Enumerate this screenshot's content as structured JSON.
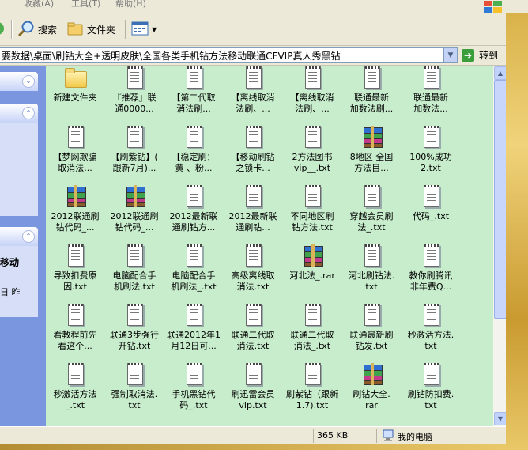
{
  "menu": {
    "items": [
      "收藏(A)",
      "工具(T)",
      "帮助(H)"
    ]
  },
  "toolbar": {
    "search_label": "搜索",
    "folders_label": "文件夹"
  },
  "address": {
    "path": "要数据\\桌面\\刷钻大全+透明皮肤\\全国各类手机钻方法移动联通CFVIP真人秀黑钻",
    "go_label": "转到"
  },
  "sidebar": {
    "text1": "移动",
    "text2": "日 昨"
  },
  "files": [
    {
      "name": "新建文件夹",
      "type": "folder"
    },
    {
      "name": "『推荐』联\n通0000...",
      "type": "txt"
    },
    {
      "name": "【第二代取\n消法刷...",
      "type": "txt"
    },
    {
      "name": "【离线取消\n法刷、...",
      "type": "txt"
    },
    {
      "name": "【离线取消\n法刷、...",
      "type": "txt"
    },
    {
      "name": "联通最新\n加数法刷...",
      "type": "txt"
    },
    {
      "name": "联通最新\n加数法...",
      "type": "txt"
    },
    {
      "name": "【梦网欺骗\n取消法...",
      "type": "txt"
    },
    {
      "name": "【刷紫钻】(\n跟新7月)...",
      "type": "txt"
    },
    {
      "name": "【稳定刷：\n黄 、粉...",
      "type": "txt"
    },
    {
      "name": "【移动刷钻\n之锁卡...",
      "type": "txt"
    },
    {
      "name": "2方法图书\nvip__.txt",
      "type": "txt"
    },
    {
      "name": "8地区 全国\n方法目...",
      "type": "rar"
    },
    {
      "name": "100%成功\n2.txt",
      "type": "txt"
    },
    {
      "name": "2012联通刷\n钻代码_...",
      "type": "rar"
    },
    {
      "name": "2012联通刷\n钻代码_...",
      "type": "rar"
    },
    {
      "name": "2012最新联\n通刷钻方...",
      "type": "txt"
    },
    {
      "name": "2012最新联\n通刷钻...",
      "type": "txt"
    },
    {
      "name": "不同地区刷\n钻方法.txt",
      "type": "txt"
    },
    {
      "name": "穿越会员刷\n法_.txt",
      "type": "txt"
    },
    {
      "name": "代码_.txt",
      "type": "txt"
    },
    {
      "name": "导致扣费原\n因.txt",
      "type": "txt"
    },
    {
      "name": "电脑配合手\n机刷法.txt",
      "type": "txt"
    },
    {
      "name": "电脑配合手\n机刷法_.txt",
      "type": "txt"
    },
    {
      "name": "高级离线取\n消法.txt",
      "type": "txt"
    },
    {
      "name": "河北法_.rar",
      "type": "rar"
    },
    {
      "name": "河北刷钻法.\ntxt",
      "type": "txt"
    },
    {
      "name": "教你刷腾讯\n非年费Q...",
      "type": "txt"
    },
    {
      "name": "看教程前先\n看这个...",
      "type": "txt"
    },
    {
      "name": "联通3步强行\n开钻.txt",
      "type": "txt"
    },
    {
      "name": "联通2012年1\n月12日可...",
      "type": "txt"
    },
    {
      "name": "联通二代取\n消法.txt",
      "type": "txt"
    },
    {
      "name": "联通二代取\n消法_.txt",
      "type": "txt"
    },
    {
      "name": "联通最新刷\n钻发.txt",
      "type": "txt"
    },
    {
      "name": "秒激活方法.\ntxt",
      "type": "txt"
    },
    {
      "name": "秒激活方法\n_.txt",
      "type": "txt"
    },
    {
      "name": "强制取消法.\ntxt",
      "type": "txt"
    },
    {
      "name": "手机黑钻代\n码_.txt",
      "type": "txt"
    },
    {
      "name": "刷迅雷会员\nvip.txt",
      "type": "txt"
    },
    {
      "name": "刷紫钻（跟新\n1.7).txt",
      "type": "txt"
    },
    {
      "name": "刷钻大全.\nrar",
      "type": "rar"
    },
    {
      "name": "刷钻防扣费.\ntxt",
      "type": "txt"
    }
  ],
  "status": {
    "size": "365 KB",
    "location": "我的电脑"
  }
}
